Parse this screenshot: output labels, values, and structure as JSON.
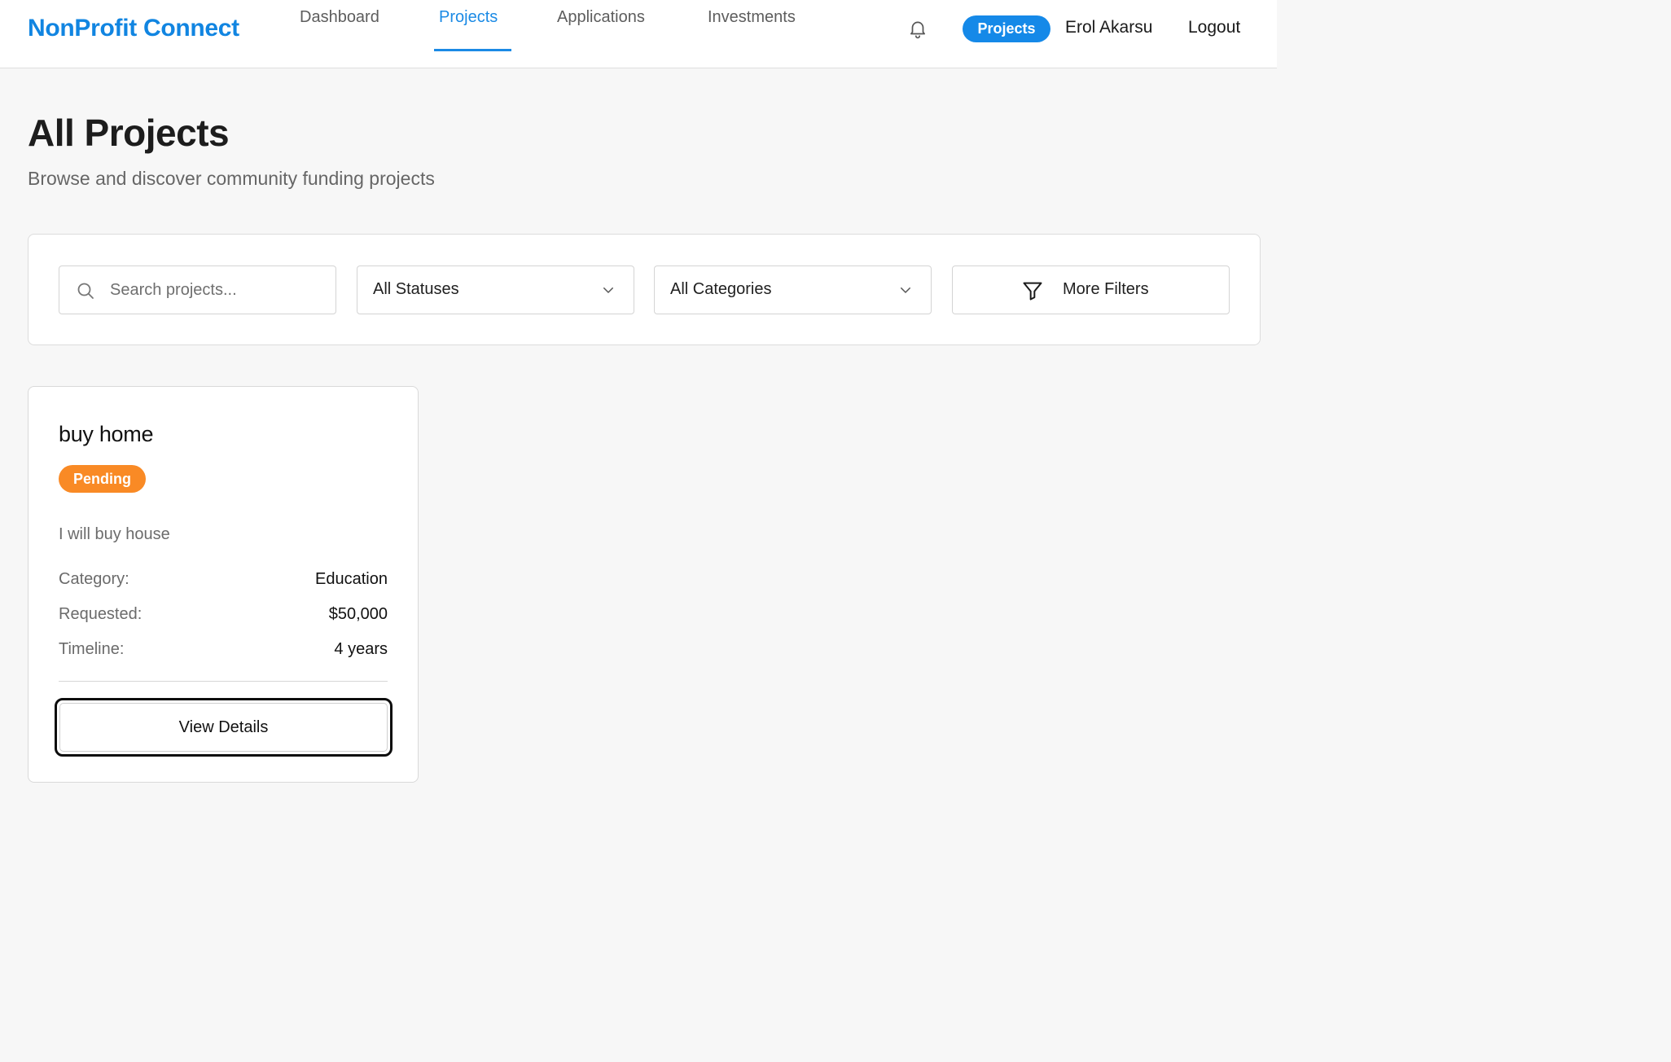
{
  "brand": "NonProfit Connect",
  "nav": {
    "items": [
      {
        "label": "Dashboard"
      },
      {
        "label": "Projects"
      },
      {
        "label": "Applications"
      },
      {
        "label": "Investments"
      }
    ],
    "active": "Projects"
  },
  "header": {
    "role_pill": "Projects",
    "user_name": "Erol Akarsu",
    "logout": "Logout",
    "bell_icon": "bell-icon"
  },
  "page": {
    "title": "All Projects",
    "subtitle": "Browse and discover community funding projects"
  },
  "filters": {
    "search_placeholder": "Search projects...",
    "status_selected": "All Statuses",
    "category_selected": "All Categories",
    "more_filters": "More Filters"
  },
  "projects": [
    {
      "title": "buy home",
      "status": "Pending",
      "status_color": "#f98a25",
      "description": "I will buy house",
      "category_label": "Category:",
      "category": "Education",
      "requested_label": "Requested:",
      "requested": "$50,000",
      "timeline_label": "Timeline:",
      "timeline": "4 years",
      "action": "View Details"
    }
  ],
  "colors": {
    "brand": "#1185e1",
    "accent": "#1589e8",
    "pending": "#f98a25"
  }
}
